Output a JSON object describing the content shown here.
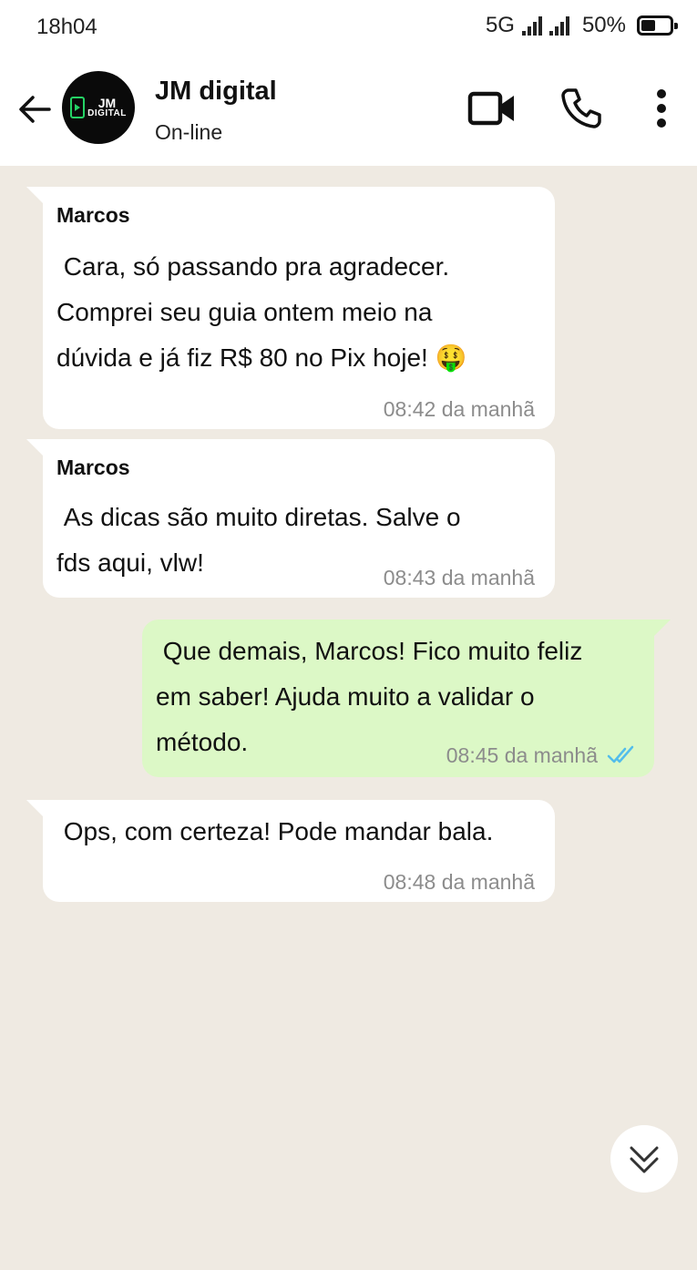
{
  "status_bar": {
    "time": "18h04",
    "network": "5G",
    "battery": "50%",
    "battery_level": 0.5
  },
  "header": {
    "avatar": {
      "line1": "JM",
      "line2": "DIGITAL"
    },
    "name": "JM digital",
    "status": "On-line",
    "icons": [
      "back-arrow-icon",
      "video-camera-icon",
      "phone-icon",
      "more-vertical-icon"
    ]
  },
  "messages": [
    {
      "direction": "incoming",
      "sender": "Marcos",
      "text": " Cara, só passando pra agradecer.\nComprei seu guia ontem meio na\ndúvida e já fiz R$ 80 no Pix hoje! ",
      "emoji": "🤑",
      "time": "08:42 da manhã"
    },
    {
      "direction": "incoming",
      "sender": "Marcos",
      "text": " As dicas são muito diretas. Salve o\nfds aqui, vlw!",
      "time": "08:43 da manhã"
    },
    {
      "direction": "outgoing",
      "text": " Que demais, Marcos! Fico muito feliz\nem saber! Ajuda muito a validar o\nmétodo.",
      "time": "08:45 da manhã",
      "read_receipt": "double-check-icon",
      "receipt_color": "#53bdeb"
    },
    {
      "direction": "incoming",
      "text": " Ops, com certeza! Pode mandar bala.",
      "time": "08:48 da manhã"
    }
  ],
  "colors": {
    "chat_background": "#efeae2",
    "incoming_bubble": "#ffffff",
    "outgoing_bubble": "#dcf8c6",
    "timestamp": "#8c8c8c",
    "accent": "#25d366"
  }
}
